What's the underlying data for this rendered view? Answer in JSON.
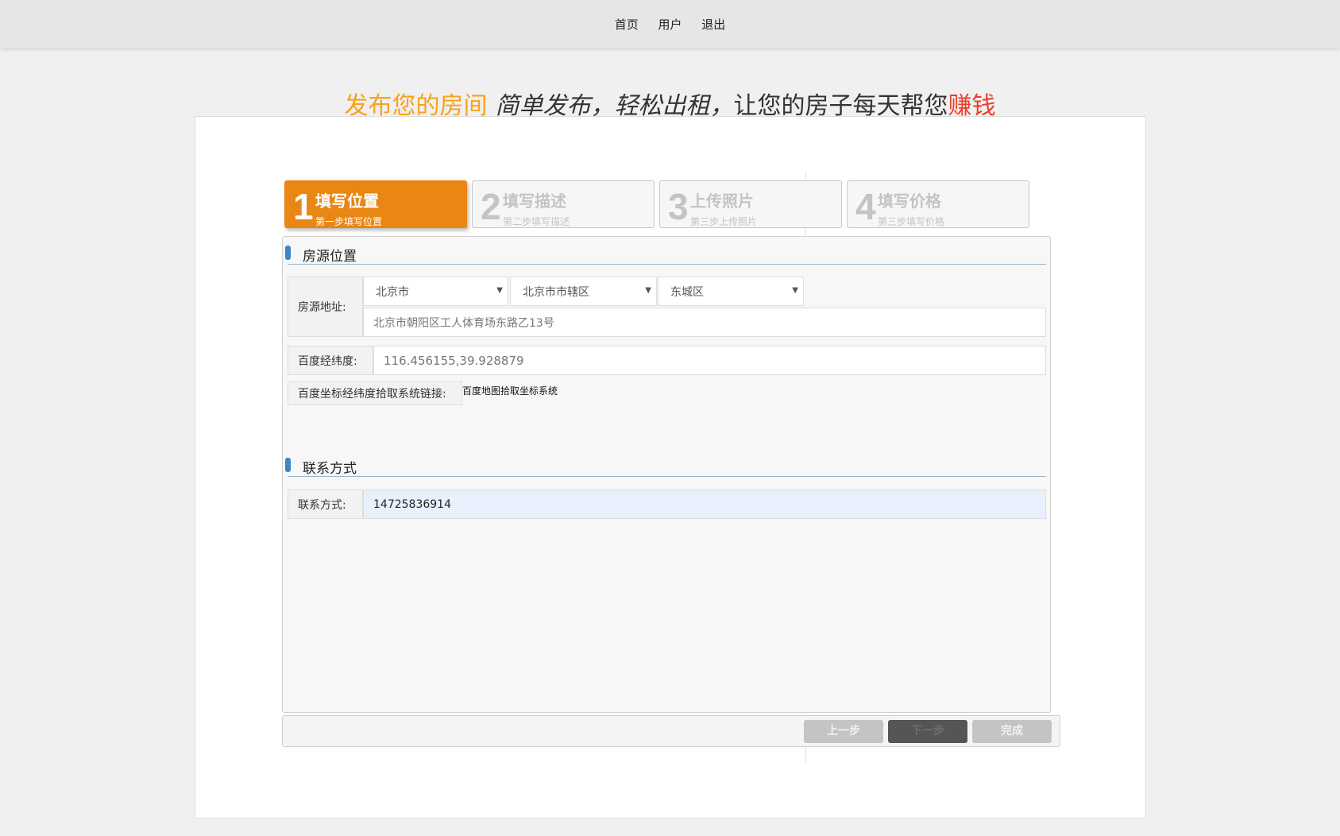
{
  "nav": {
    "home": "首页",
    "user": "用户",
    "logout": "退出"
  },
  "headline": {
    "part1": "发布您的房间",
    "part2": "简单发布，轻松出租，",
    "part3": "让您的房子每天帮您",
    "part4": "赚钱"
  },
  "steps": [
    {
      "num": "1",
      "title": "填写位置",
      "sub": "第一步填写位置",
      "state": "active"
    },
    {
      "num": "2",
      "title": "填写描述",
      "sub": "第二步填写描述",
      "state": "inactive"
    },
    {
      "num": "3",
      "title": "上传照片",
      "sub": "第三步上传照片",
      "state": "inactive"
    },
    {
      "num": "4",
      "title": "填写价格",
      "sub": "第三步填写价格",
      "state": "inactive"
    }
  ],
  "location_section": {
    "title": "房源位置",
    "address_label": "房源地址:",
    "province": "北京市",
    "city": "北京市市辖区",
    "district": "东城区",
    "address_value": "北京市朝阳区工人体育场东路乙13号",
    "coords_label": "百度经纬度:",
    "coords_value": "116.456155,39.928879",
    "picker_label": "百度坐标经纬度拾取系统链接:",
    "picker_link": "百度地图拾取坐标系统"
  },
  "contact_section": {
    "title": "联系方式",
    "phone_label": "联系方式:",
    "phone_value": "14725836914"
  },
  "buttons": {
    "prev": "上一步",
    "next": "下一步",
    "finish": "完成"
  },
  "colors": {
    "accent_orange": "#ea8613",
    "headline_orange": "#f7a21b",
    "headline_red": "#e8402b",
    "section_marker": "#3b86c8",
    "autofill_bg": "#e8f0fe"
  }
}
